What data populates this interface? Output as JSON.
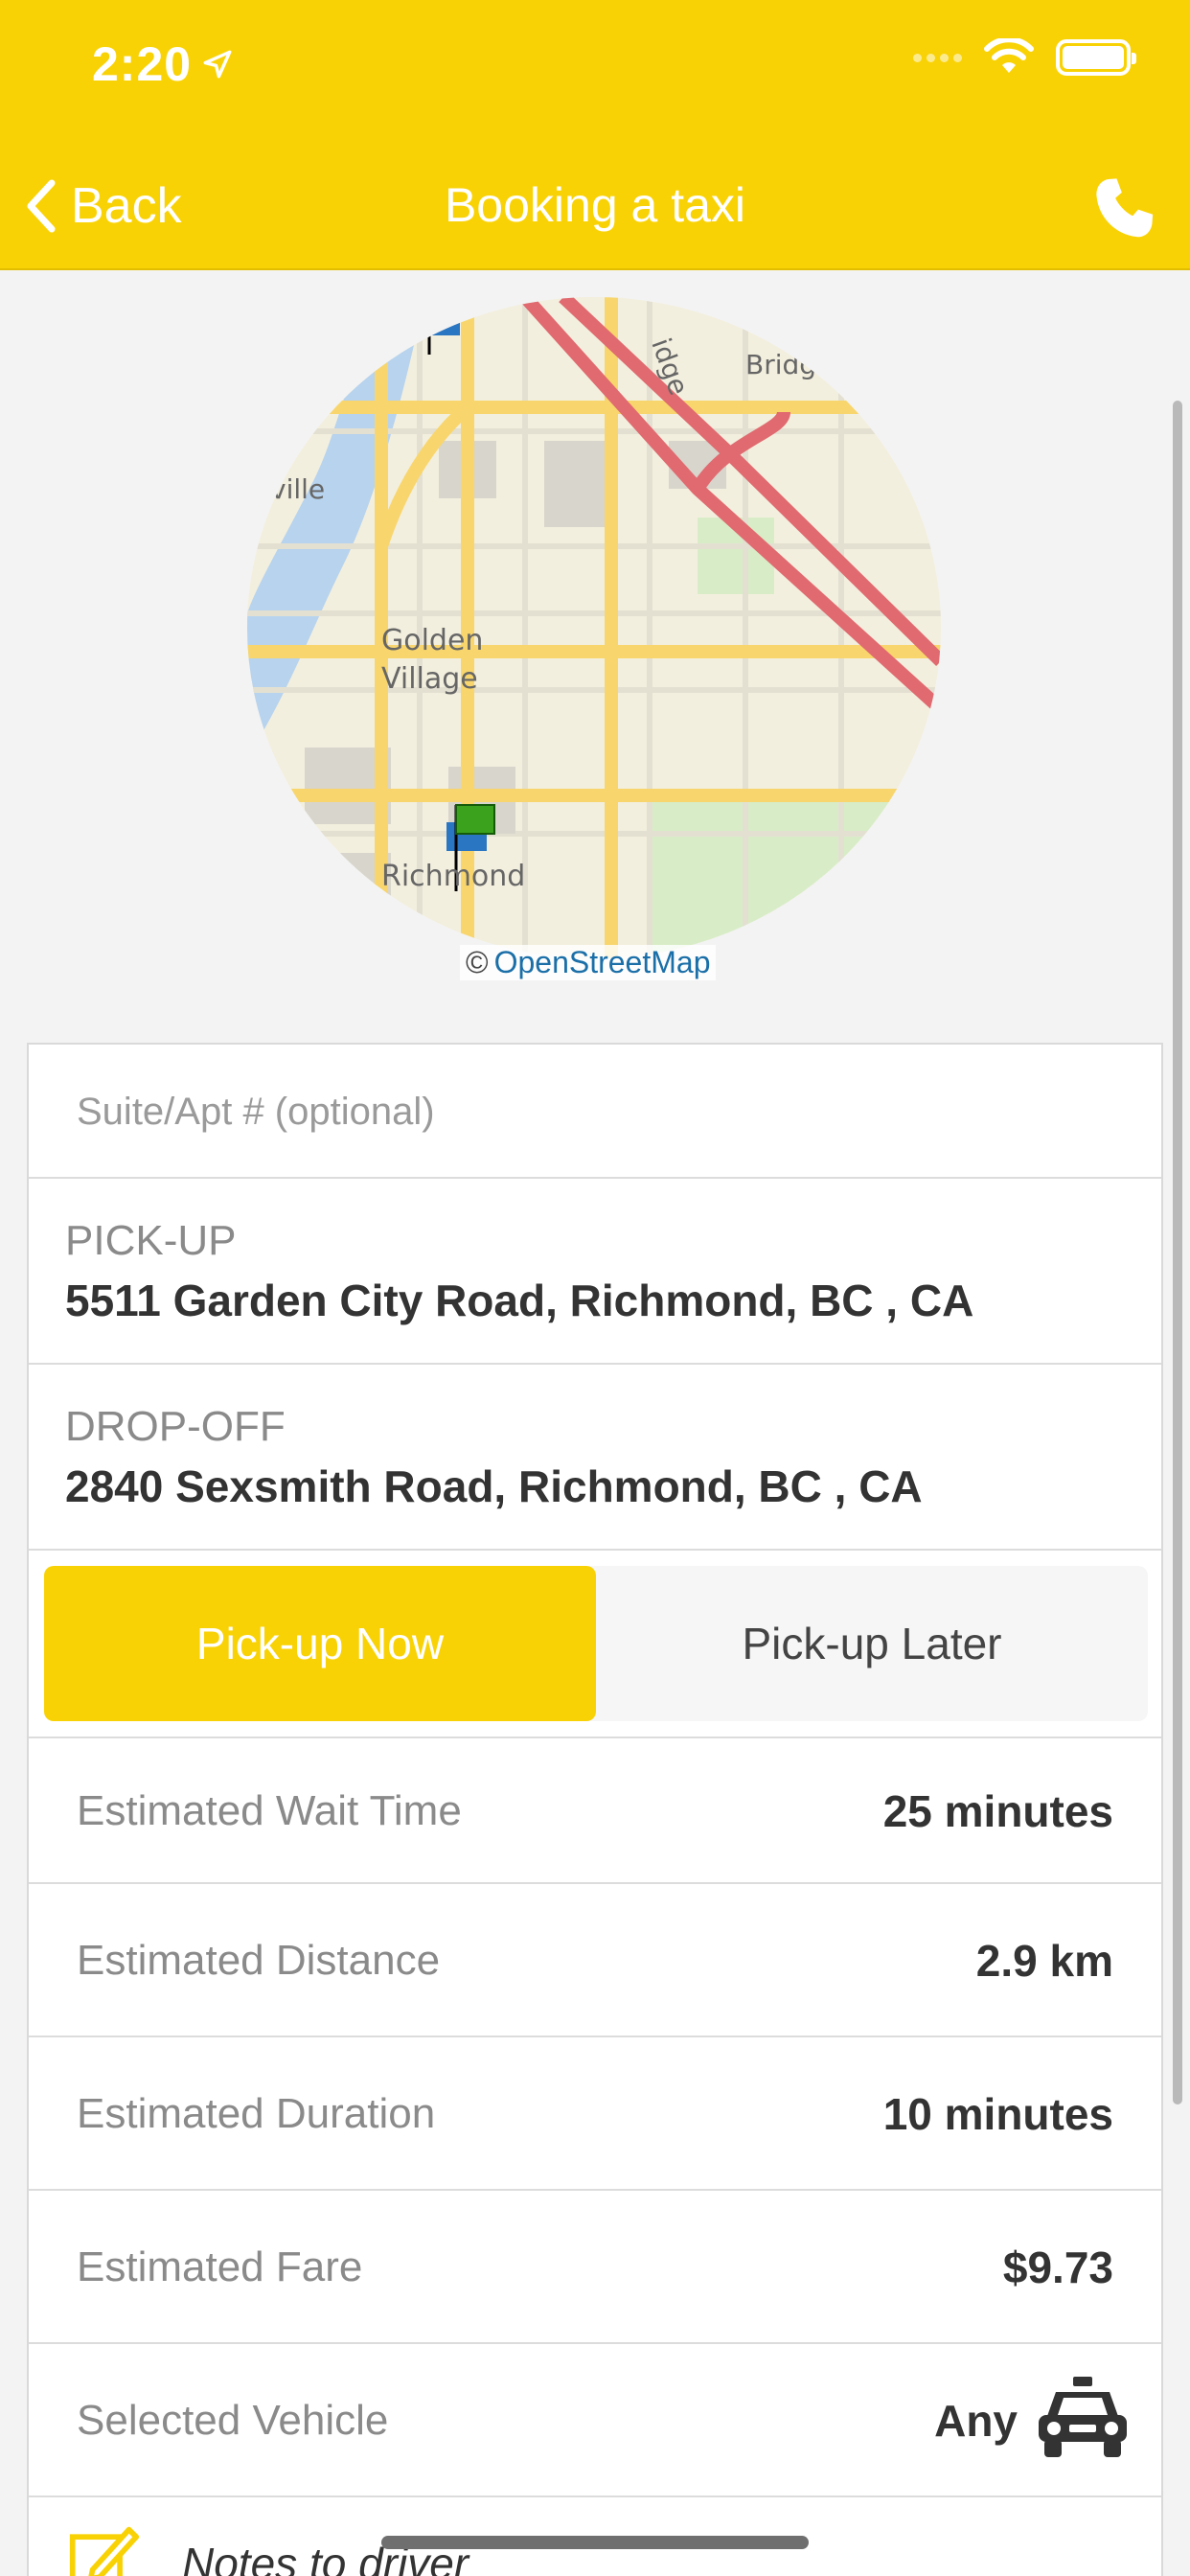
{
  "status_bar": {
    "time": "2:20"
  },
  "header": {
    "back_label": "Back",
    "title": "Booking a taxi"
  },
  "map": {
    "labels": {
      "golden": "Golden",
      "village": "Village",
      "richmond": "Richmond",
      "ville": "ville",
      "bridge": "Bridge",
      "ridge": "idge"
    },
    "attribution": "OpenStreetMap",
    "attribution_prefix": "©"
  },
  "form": {
    "suite_placeholder": "Suite/Apt # (optional)",
    "pickup": {
      "label": "PICK-UP",
      "address": "5511 Garden City Road, Richmond, BC , CA"
    },
    "dropoff": {
      "label": "DROP-OFF",
      "address": "2840 Sexsmith Road, Richmond, BC , CA"
    },
    "pickup_now": "Pick-up Now",
    "pickup_later": "Pick-up Later",
    "estimates": {
      "wait_label": "Estimated Wait Time",
      "wait_value": "25 minutes",
      "distance_label": "Estimated Distance",
      "distance_value": "2.9 km",
      "duration_label": "Estimated Duration",
      "duration_value": "10 minutes",
      "fare_label": "Estimated Fare",
      "fare_value": "$9.73",
      "vehicle_label": "Selected Vehicle",
      "vehicle_value": "Any"
    },
    "notes_label": "Notes to driver"
  },
  "colors": {
    "brand": "#f9d205",
    "text": "#333333",
    "muted": "#8a8a8a"
  }
}
